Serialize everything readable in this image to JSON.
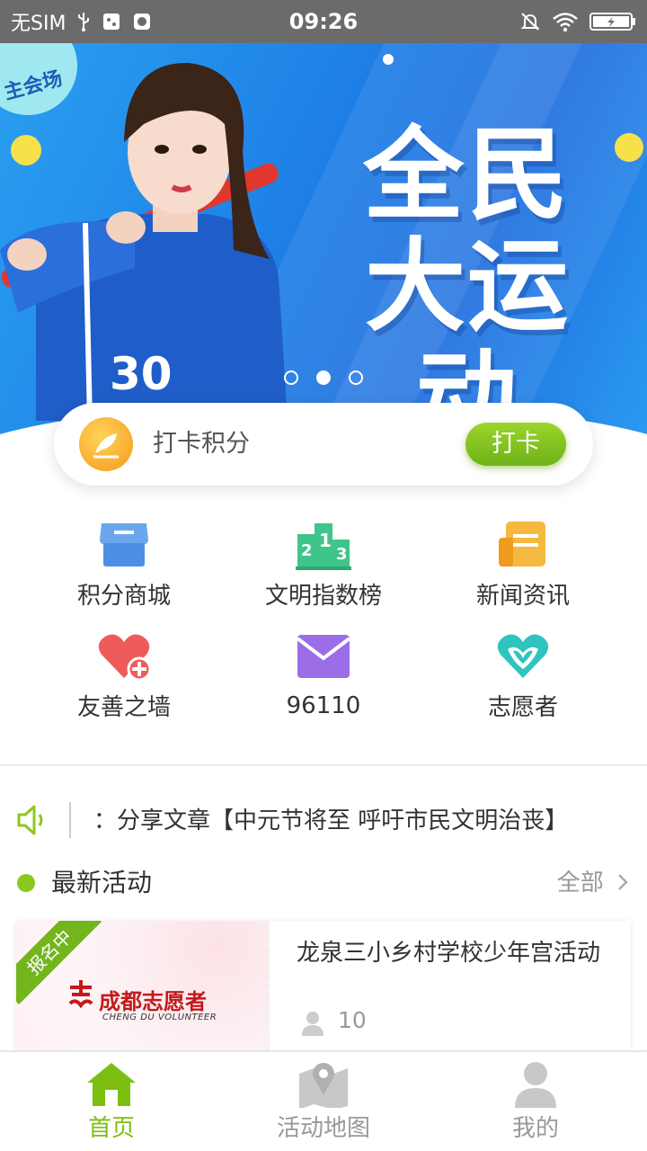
{
  "status_bar": {
    "carrier": "无SIM",
    "time": "09:26"
  },
  "banner": {
    "line1": "全民",
    "line2": "大运动",
    "corner_badge": "主会场",
    "page_count": 3,
    "active_page": 2
  },
  "checkin": {
    "label": "打卡积分",
    "button": "打卡"
  },
  "grid": {
    "items": [
      {
        "label": "积分商城",
        "icon": "store-icon"
      },
      {
        "label": "文明指数榜",
        "icon": "ranking-podium-icon"
      },
      {
        "label": "新闻资讯",
        "icon": "news-icon"
      },
      {
        "label": "友善之墙",
        "icon": "heart-plus-icon"
      },
      {
        "label": "96110",
        "icon": "mail-icon"
      },
      {
        "label": "志愿者",
        "icon": "volunteer-heart-icon"
      }
    ]
  },
  "notice": {
    "text": "：分享文章【中元节将至 呼吁市民文明治丧】"
  },
  "section": {
    "title": "最新活动",
    "more": "全部"
  },
  "activity": {
    "status": "报名中",
    "logo_text": "成都志愿者",
    "logo_sub": "CHENG DU VOLUNTEER",
    "title": "龙泉三小乡村学校少年宫活动",
    "participants": "10"
  },
  "nav": {
    "items": [
      {
        "label": "首页",
        "icon": "home-icon",
        "active": true
      },
      {
        "label": "活动地图",
        "icon": "map-icon",
        "active": false
      },
      {
        "label": "我的",
        "icon": "profile-icon",
        "active": false
      }
    ]
  },
  "colors": {
    "accent_green": "#7cbf12",
    "banner_blue": "#1f6fe0"
  }
}
